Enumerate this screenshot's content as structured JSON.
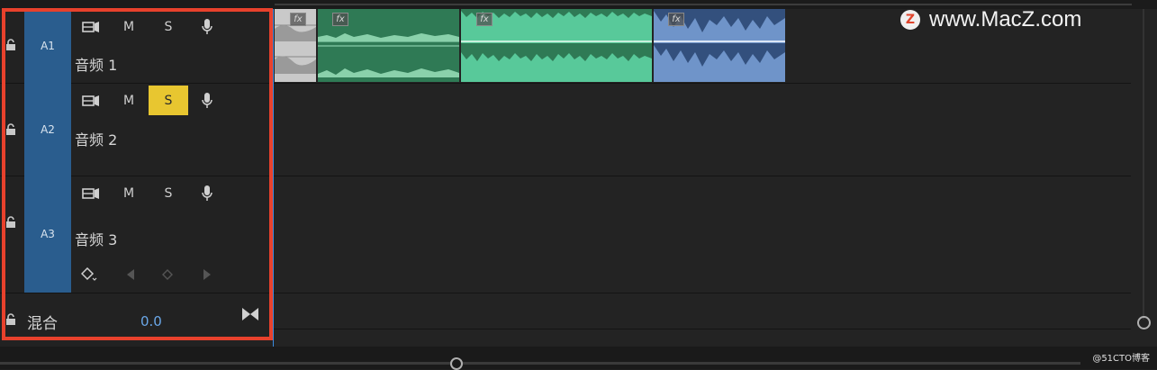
{
  "watermark": {
    "text": "www.MacZ.com",
    "logo_letter": "Z"
  },
  "credit": "@51CTO博客",
  "tracks": [
    {
      "id": "A1",
      "name": "音频 1",
      "buttons": {
        "mute": "M",
        "solo": "S"
      },
      "solo_active": false
    },
    {
      "id": "A2",
      "name": "音频 2",
      "buttons": {
        "mute": "M",
        "solo": "S"
      },
      "solo_active": true
    },
    {
      "id": "A3",
      "name": "音频 3",
      "buttons": {
        "mute": "M",
        "solo": "S"
      },
      "solo_active": false
    }
  ],
  "mix": {
    "label": "混合",
    "value": "0.0"
  },
  "clips": [
    {
      "label": "fx",
      "color": "#cfcfcf"
    },
    {
      "label": "fx",
      "color": "#2f7a55"
    },
    {
      "label": "fx",
      "color": "#58c99a"
    },
    {
      "label": "fx",
      "color": "#6f94c9"
    }
  ],
  "colors": {
    "highlight": "#e8412c",
    "track_label_bg": "#2a5d8e",
    "solo_on": "#e8c630",
    "mix_value": "#6aa7e8"
  }
}
